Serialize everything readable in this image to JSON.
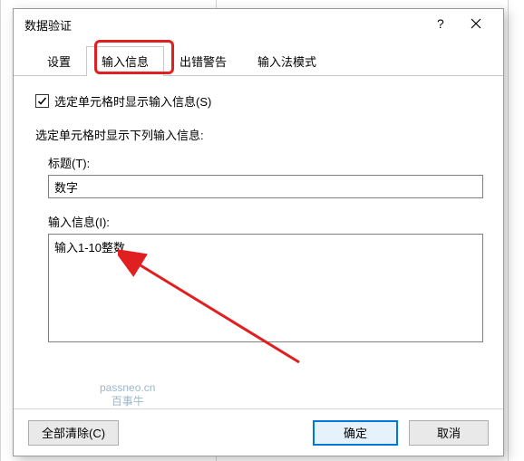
{
  "dialog": {
    "title": "数据验证",
    "help_tooltip": "?",
    "close_tooltip": "×"
  },
  "tabs": {
    "settings": "设置",
    "input_message": "输入信息",
    "error_alert": "出错警告",
    "ime_mode": "输入法模式"
  },
  "body": {
    "show_checkbox_label": "选定单元格时显示输入信息(S)",
    "show_checkbox_checked": true,
    "section_label": "选定单元格时显示下列输入信息:",
    "title_label": "标题(T):",
    "title_value": "数字",
    "message_label": "输入信息(I):",
    "message_value": "输入1-10整数"
  },
  "buttons": {
    "clear_all": "全部清除(C)",
    "ok": "确定",
    "cancel": "取消"
  },
  "watermark": {
    "line1": "passneo.cn",
    "line2": "百事牛"
  }
}
